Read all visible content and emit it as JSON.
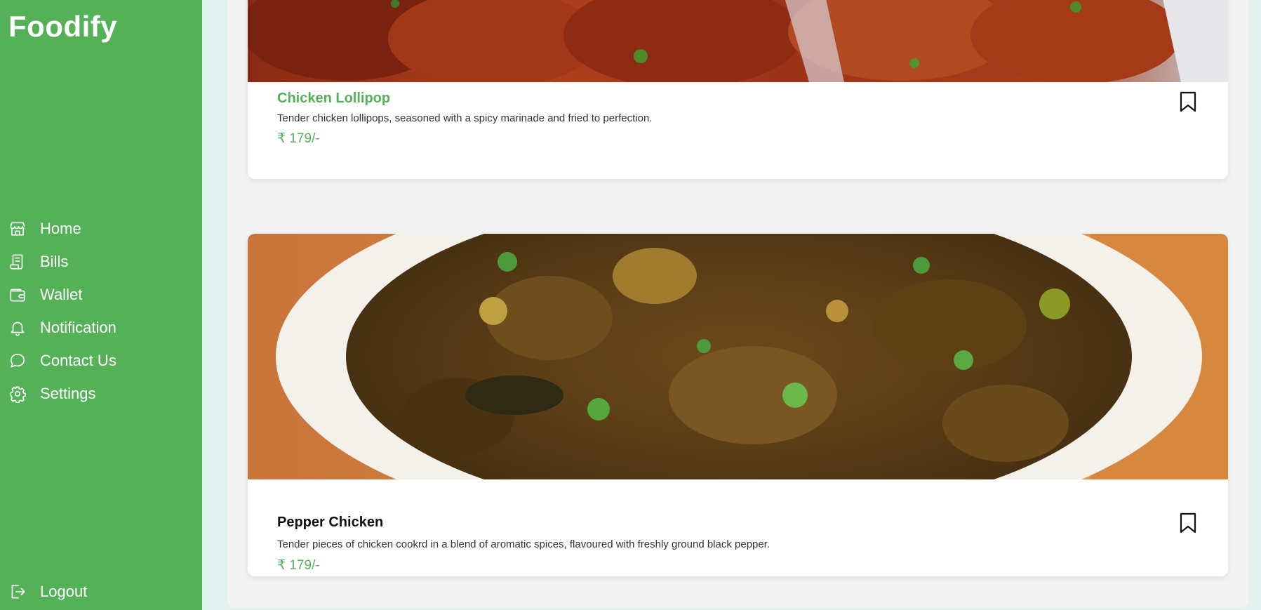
{
  "app": {
    "brand": "Foodify",
    "accent_color": "#54b158"
  },
  "sidebar": {
    "items": [
      {
        "label": "Home",
        "icon": "store-icon"
      },
      {
        "label": "Bills",
        "icon": "receipt-icon"
      },
      {
        "label": "Wallet",
        "icon": "wallet-icon"
      },
      {
        "label": "Notification",
        "icon": "bell-icon"
      },
      {
        "label": "Contact Us",
        "icon": "chat-icon"
      },
      {
        "label": "Settings",
        "icon": "gear-icon"
      }
    ],
    "logout": {
      "label": "Logout",
      "icon": "logout-icon"
    }
  },
  "dishes": [
    {
      "name": "Chicken Lollipop",
      "description": "Tender chicken lollipops, seasoned with a spicy marinade and fried to perfection.",
      "price": "₹ 179/-",
      "bookmark_icon": "bookmark-icon",
      "title_color": "#54b158"
    },
    {
      "name": "Pepper Chicken",
      "description": "Tender pieces of chicken cookrd in a blend of aromatic spices, flavoured with freshly ground black pepper.",
      "price": "₹ 179/-",
      "bookmark_icon": "bookmark-icon",
      "title_color": "#111111"
    }
  ]
}
